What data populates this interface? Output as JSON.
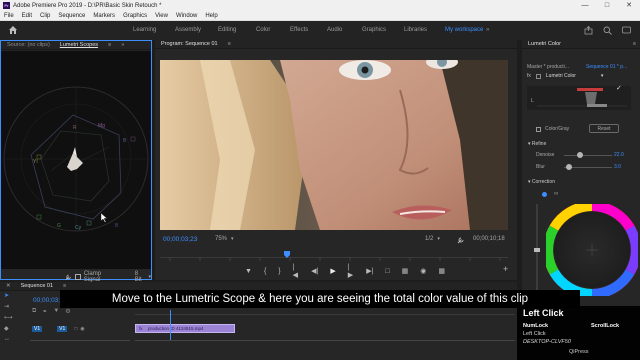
{
  "titlebar": {
    "title": "Adobe Premiere Pro 2019 - D:\\PR\\Basic Skin Retouch *",
    "app_icon": "Pr"
  },
  "menubar": {
    "items": [
      "File",
      "Edit",
      "Clip",
      "Sequence",
      "Markers",
      "Graphics",
      "View",
      "Window",
      "Help"
    ]
  },
  "workspaces": {
    "items": [
      "Learning",
      "Assembly",
      "Editing",
      "Color",
      "Effects",
      "Audio",
      "Graphics",
      "Libraries",
      "My workspace"
    ],
    "active": "My workspace"
  },
  "source_panel": {
    "tabs": [
      "Source: (no clips)",
      "Lumetri Scopes"
    ],
    "active_tab": "Lumetri Scopes",
    "clamp_signal_label": "Clamp Signal",
    "bit_depth": "8 Bit"
  },
  "program_panel": {
    "tab": "Program: Sequence 01",
    "timecode_current": "00;00;03;23",
    "zoom": "75%",
    "resolution": "1/2",
    "timecode_duration": "00;00;10;18"
  },
  "lumetri_color": {
    "title": "Lumetri Color",
    "master_label": "Master * producti...",
    "sequence_label": "Sequence 01 * p...",
    "effect_name": "Lumetri Color",
    "color_gray_label": "Color/Gray",
    "reset_label": "Reset",
    "refine_label": "Refine",
    "denoise_label": "Denoise",
    "denoise_value": "22.0",
    "blur_label": "Blur",
    "blur_value": "3.0",
    "correction_label": "Correction",
    "l_label": "L"
  },
  "timeline": {
    "tab": "Sequence 01",
    "timecode": "00;00;03;23",
    "tracks": [
      "V1",
      "V1"
    ],
    "clip_name": "production ID 4134515.mp4"
  },
  "subtitle": "Move to the Lumetric Scope & here you are seeing the total color value of this clip",
  "key_overlay": {
    "action": "Left Click",
    "numlock": "NumLock",
    "scrolllock": "ScrollLock",
    "left_click": "Left Click",
    "machine": "DESKTOP-CLVF50",
    "brand": "QiPress"
  },
  "colors": {
    "accent": "#3d8eff",
    "panel_bg": "#262626",
    "clip_purple": "#9b84d6"
  },
  "icons": {
    "home": "home-icon",
    "wrench": "wrench-icon",
    "play": "play-icon"
  }
}
